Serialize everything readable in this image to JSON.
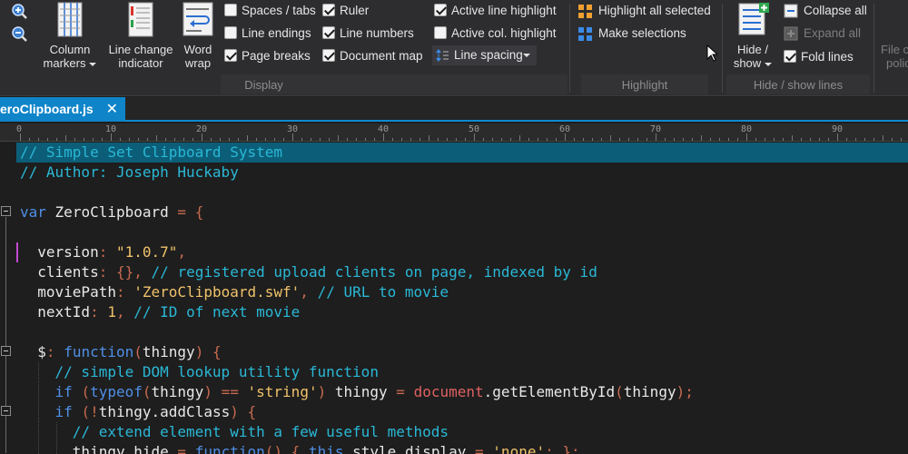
{
  "ribbon": {
    "big_buttons": {
      "column_markers": [
        "Column",
        "markers"
      ],
      "line_change": [
        "Line change",
        "indicator"
      ],
      "word_wrap": [
        "Word",
        "wrap"
      ],
      "hide_show": [
        "Hide /",
        "show"
      ],
      "file_cut": [
        "File c",
        "polic"
      ]
    },
    "display_col1": [
      {
        "label": "Spaces / tabs",
        "checked": false
      },
      {
        "label": "Line endings",
        "checked": false
      },
      {
        "label": "Page breaks",
        "checked": true
      }
    ],
    "display_col2": [
      {
        "label": "Ruler",
        "checked": true
      },
      {
        "label": "Line numbers",
        "checked": true
      },
      {
        "label": "Document map",
        "checked": true
      }
    ],
    "display_col3": [
      {
        "label": "Active line highlight",
        "checked": true
      },
      {
        "label": "Active col. highlight",
        "checked": false
      }
    ],
    "line_spacing": "Line spacing",
    "highlight_items": [
      "Highlight all selected",
      "Make selections"
    ],
    "hide_items": [
      {
        "label": "Collapse all",
        "disabled": false
      },
      {
        "label": "Expand all",
        "disabled": true
      }
    ],
    "fold_lines": {
      "label": "Fold lines",
      "checked": true
    },
    "groups": {
      "display": "Display",
      "highlight": "Highlight",
      "hide_show": "Hide / show lines"
    }
  },
  "tab": {
    "title": "eroClipboard.js",
    "close": "✕"
  },
  "ruler": {
    "numbers": [
      "0",
      "10",
      "20",
      "30",
      "40",
      "50",
      "60",
      "70",
      "80",
      "90"
    ]
  },
  "editor": {
    "lines": [
      "// Simple Set Clipboard System",
      "// Author: Joseph Huckaby",
      "",
      "var ZeroClipboard = {",
      "",
      "  version: \"1.0.7\",",
      "  clients: {}, // registered upload clients on page, indexed by id",
      "  moviePath: 'ZeroClipboard.swf', // URL to movie",
      "  nextId: 1, // ID of next movie",
      "",
      "  $: function(thingy) {",
      "    // simple DOM lookup utility function",
      "    if (typeof(thingy) == 'string') thingy = document.getElementById(thingy);",
      "    if (!thingy.addClass) {",
      "      // extend element with a few useful methods",
      "      thingy.hide = function() { this.style.display = 'none'; };"
    ]
  },
  "colors": {
    "accent": "#0f84c9",
    "active_line": "#0c5e78",
    "comment": "#2ab8d6",
    "keyword": "#4f8fe6",
    "string": "#f0c26a",
    "punctuation": "#c86a50"
  }
}
